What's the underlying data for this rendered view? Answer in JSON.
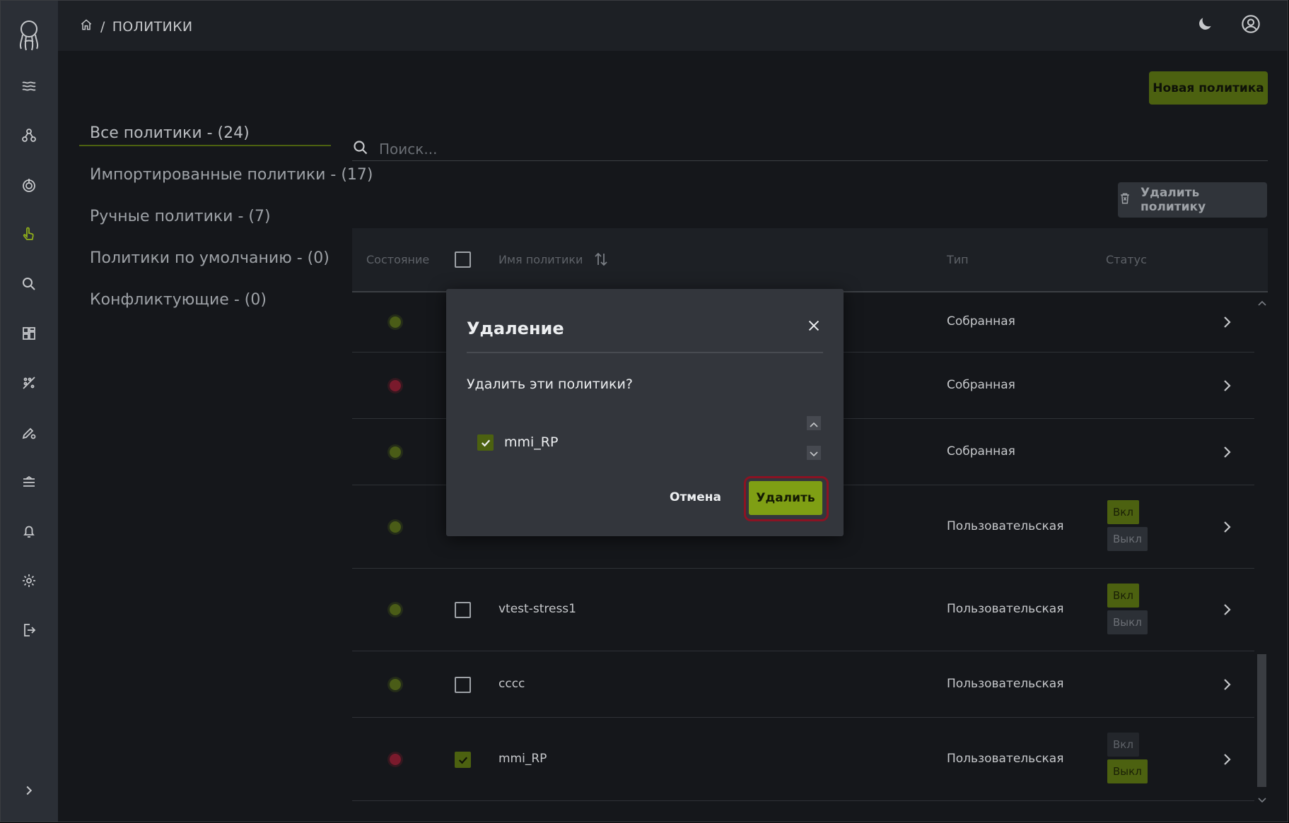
{
  "header": {
    "breadcrumb_separator": "/",
    "breadcrumb_current": "ПОЛИТИКИ",
    "icons": [
      "home-icon",
      "moon-icon",
      "user-circle-icon"
    ]
  },
  "sidebar": {
    "logo": "octopus-logo-icon",
    "items": [
      {
        "icon": "waves-icon",
        "active": false
      },
      {
        "icon": "nodes-icon",
        "active": false
      },
      {
        "icon": "power-icon",
        "active": false
      },
      {
        "icon": "hand-pointer-icon",
        "active": true
      },
      {
        "icon": "search-icon",
        "active": false
      },
      {
        "icon": "dashboard-icon",
        "active": false
      },
      {
        "icon": "chart-scatter-icon",
        "active": false
      },
      {
        "icon": "pen-gear-icon",
        "active": false
      },
      {
        "icon": "layers-icon",
        "active": false
      },
      {
        "icon": "bell-icon",
        "active": false
      },
      {
        "icon": "gear-icon",
        "active": false
      },
      {
        "icon": "logout-icon",
        "active": false
      }
    ],
    "expand_icon": "chevron-right-icon"
  },
  "actions": {
    "new_policy": "Новая политика",
    "delete_policy": "Удалить политику"
  },
  "filters": [
    {
      "label": "Все политики - (24)",
      "active": true
    },
    {
      "label": "Импортированные политики - (17)",
      "active": false
    },
    {
      "label": "Ручные политики - (7)",
      "active": false
    },
    {
      "label": "Политики по умолчанию - (0)",
      "active": false
    },
    {
      "label": "Конфликтующие - (0)",
      "active": false
    }
  ],
  "search": {
    "placeholder": "Поиск..."
  },
  "table": {
    "columns": {
      "state": "Состояние",
      "name": "Имя политики",
      "type": "Тип",
      "status": "Статус"
    },
    "rows": [
      {
        "state": "green",
        "name": "",
        "type": "Собранная",
        "checked": false,
        "toggle": null
      },
      {
        "state": "red",
        "name": "",
        "type": "Собранная",
        "checked": false,
        "toggle": null
      },
      {
        "state": "green",
        "name": "",
        "type": "Собранная",
        "checked": false,
        "toggle": null
      },
      {
        "state": "green",
        "name": "",
        "type": "Пользовательская",
        "checked": false,
        "toggle": "on"
      },
      {
        "state": "green",
        "name": "vtest-stress1",
        "type": "Пользовательская",
        "checked": false,
        "toggle": "on"
      },
      {
        "state": "green",
        "name": "cccc",
        "type": "Пользовательская",
        "checked": false,
        "toggle": null
      },
      {
        "state": "red",
        "name": "mmi_RP",
        "type": "Пользовательская",
        "checked": true,
        "toggle": "off"
      }
    ],
    "toggle_on_label": "Вкл",
    "toggle_off_label": "Выкл"
  },
  "modal": {
    "title": "Удаление",
    "question": "Удалить эти политики?",
    "items": [
      "mmi_RP"
    ],
    "cancel": "Отмена",
    "confirm": "Удалить"
  },
  "colors": {
    "accent": "#7f9f14",
    "accent_dark": "#4c6110",
    "danger_ring": "#8b1323",
    "state_red": "#7a1a2c",
    "state_green": "#4a5c17"
  }
}
